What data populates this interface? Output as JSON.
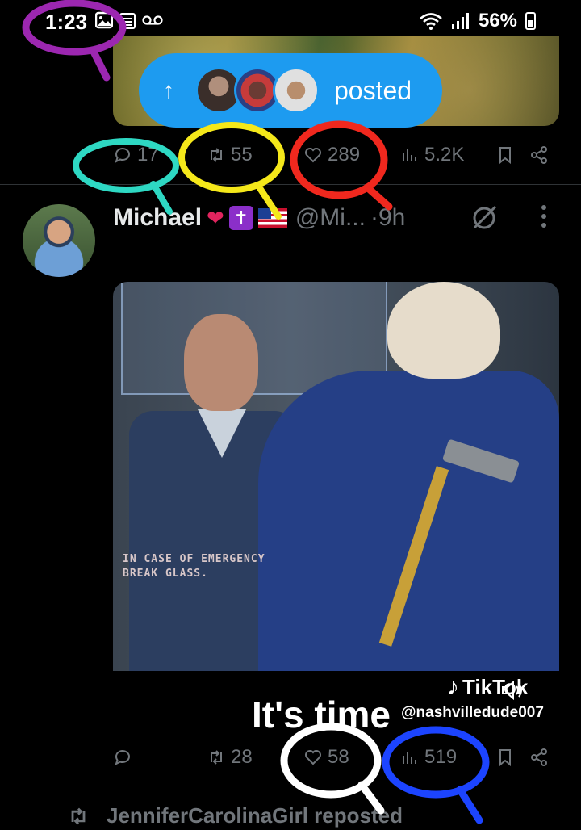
{
  "status_bar": {
    "time": "1:23",
    "battery": "56%",
    "icons": [
      "image-icon",
      "calendar-icon",
      "voicemail-icon",
      "wifi-icon",
      "signal-icon",
      "battery-icon"
    ]
  },
  "top_post": {
    "posted_label": "posted",
    "actions": {
      "replies": "17",
      "reposts": "55",
      "likes": "289",
      "views": "5.2K"
    }
  },
  "tweet": {
    "author_name": "Michael",
    "handle": "@Mi...",
    "time": "·9h",
    "media": {
      "caption_line1": "IN CASE OF EMERGENCY",
      "caption_line2": "BREAK GLASS.",
      "tiktok_label": "TikTok",
      "tiktok_handle": "@nashvilledude007",
      "overlay_text": "It's time"
    },
    "actions": {
      "replies": "",
      "reposts": "28",
      "likes": "58",
      "views": "519"
    }
  },
  "next_item": {
    "repost_label": "JenniferCarolinaGirl reposted"
  },
  "colors": {
    "accent": "#1d9bf0",
    "muted": "#71767b",
    "annot_purple": "#9c27b0",
    "annot_cyan": "#2ed8c3",
    "annot_yellow": "#f5e81a",
    "annot_red": "#f0281e",
    "annot_white": "#ffffff",
    "annot_blue": "#1c44ff"
  }
}
